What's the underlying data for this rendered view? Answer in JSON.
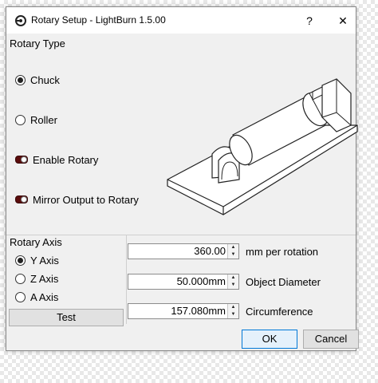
{
  "window": {
    "title": "Rotary Setup - LightBurn 1.5.00",
    "help_label": "?",
    "close_label": "✕"
  },
  "rotary_type": {
    "group_label": "Rotary Type",
    "options": [
      {
        "label": "Chuck",
        "checked": true
      },
      {
        "label": "Roller",
        "checked": false
      }
    ],
    "toggles": [
      {
        "label": "Enable Rotary",
        "on": false
      },
      {
        "label": "Mirror Output to Rotary",
        "on": false
      }
    ]
  },
  "rotary_axis": {
    "group_label": "Rotary Axis",
    "options": [
      {
        "label": "Y Axis",
        "checked": true
      },
      {
        "label": "Z Axis",
        "checked": false
      },
      {
        "label": "A Axis",
        "checked": false
      }
    ],
    "test_label": "Test"
  },
  "settings": {
    "mm_per_rotation": {
      "value": "360.00",
      "label": "mm per rotation"
    },
    "object_diameter": {
      "value": "50.000mm",
      "label": "Object Diameter"
    },
    "circumference": {
      "value": "157.080mm",
      "label": "Circumference"
    }
  },
  "footer": {
    "ok_label": "OK",
    "cancel_label": "Cancel"
  },
  "icons": {
    "app": "lightburn-logo-icon",
    "spin_up": "▲",
    "spin_down": "▼"
  }
}
